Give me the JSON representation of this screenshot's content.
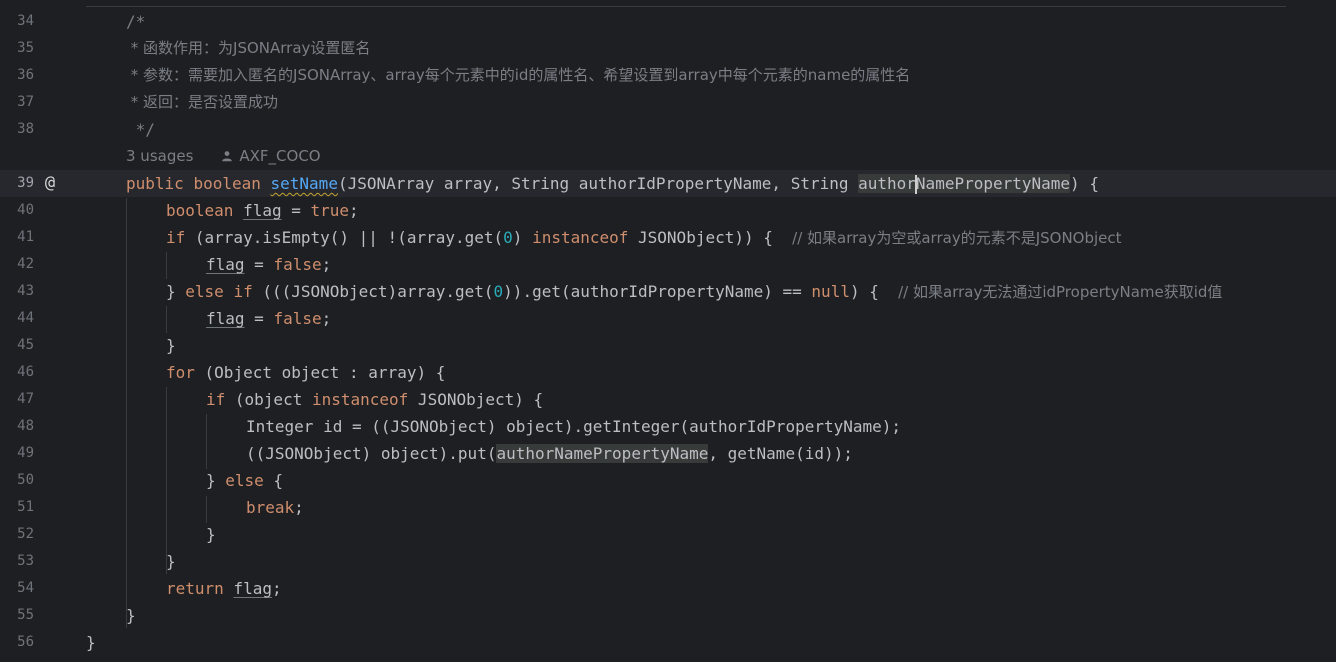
{
  "editor": {
    "gutter": {
      "line_numbers": [
        "34",
        "35",
        "36",
        "37",
        "38",
        "39",
        "40",
        "41",
        "42",
        "43",
        "44",
        "45",
        "46",
        "47",
        "48",
        "49",
        "50",
        "51",
        "52",
        "53",
        "54",
        "55",
        "56"
      ],
      "override_marker": "@",
      "override_icon": "override-at-icon"
    },
    "inlay_hint": {
      "usages": "3 usages",
      "author": "AXF_COCO",
      "author_icon": "user-icon"
    },
    "code": {
      "l34": "/*",
      "l35": " * 函数作用：为JSONArray设置匿名",
      "l36": " * 参数：需要加入匿名的JSONArray、array每个元素中的id的属性名、希望设置到array中每个元素的name的属性名",
      "l37": " * 返回：是否设置成功",
      "l38": " */",
      "l39": {
        "kw_public": "public",
        "kw_boolean": "boolean",
        "method": "setName",
        "params_a": "(JSONArray array, String authorIdPropertyName, String ",
        "param_hl_1": "author",
        "param_hl_2": "NamePropertyName",
        "tail": ") {"
      },
      "l40": {
        "kw": "boolean",
        "var": "flag",
        "mid": " = ",
        "val": "true",
        "end": ";"
      },
      "l41": {
        "kw_if": "if",
        "p1": " (array.isEmpty() || !(array.get(",
        "n0": "0",
        "p2": ") ",
        "kw_instanceof": "instanceof",
        "p3": " JSONObject)) {  ",
        "comment": "// 如果array为空或array的元素不是JSONObject"
      },
      "l42": {
        "var": "flag",
        "mid": " = ",
        "val": "false",
        "end": ";"
      },
      "l43": {
        "p0": "} ",
        "kw_else": "else",
        "kw_if": "if",
        "p1": " (((JSONObject)array.get(",
        "n0": "0",
        "p2": ")).get(authorIdPropertyName) == ",
        "kw_null": "null",
        "p3": ") {  ",
        "comment": "// 如果array无法通过idPropertyName获取id值"
      },
      "l44": {
        "var": "flag",
        "mid": " = ",
        "val": "false",
        "end": ";"
      },
      "l45": "}",
      "l46": {
        "kw": "for",
        "rest": " (Object object : array) {"
      },
      "l47": {
        "kw_if": "if",
        "p1": " (object ",
        "kw_instanceof": "instanceof",
        "p2": " JSONObject) {"
      },
      "l48": "Integer id = ((JSONObject) object).getInteger(authorIdPropertyName);",
      "l49": {
        "p1": "((JSONObject) object).put(",
        "hl": "authorNamePropertyName",
        "p2": ", getName(id));"
      },
      "l50": {
        "p0": "} ",
        "kw": "else",
        "p1": " {"
      },
      "l51": {
        "kw": "break",
        "p1": ";"
      },
      "l52": "}",
      "l53": "}",
      "l54": {
        "kw": "return",
        "var": "flag",
        "end": ";"
      },
      "l55": "}",
      "l56": "}"
    },
    "colors": {
      "background": "#1e1f22",
      "keyword": "#cf8e6d",
      "comment": "#7a7e85",
      "number": "#2aacb8",
      "method_declaration": "#56a8f5",
      "text": "#bcbec4",
      "line_number": "#6f737a"
    }
  }
}
